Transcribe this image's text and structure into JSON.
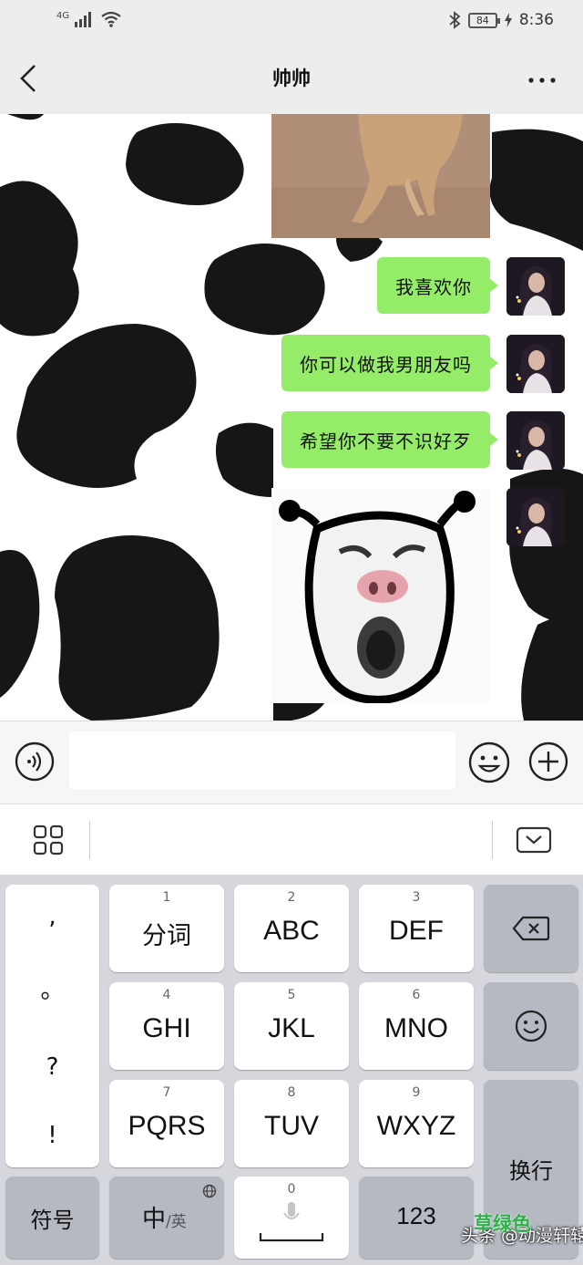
{
  "status_bar": {
    "network": "4G",
    "battery": "84",
    "time": "8:36"
  },
  "header": {
    "title": "帅帅"
  },
  "messages": [
    {
      "text": "我喜欢你"
    },
    {
      "text": "你可以做我男朋友吗"
    },
    {
      "text": "希望你不要不识好歹"
    }
  ],
  "input": {
    "value": ""
  },
  "keyboard": {
    "punctuation": [
      ",",
      "。",
      "?",
      "!"
    ],
    "keys": [
      {
        "num": "1",
        "label": "分词"
      },
      {
        "num": "2",
        "label": "ABC"
      },
      {
        "num": "3",
        "label": "DEF"
      },
      {
        "num": "4",
        "label": "GHI"
      },
      {
        "num": "5",
        "label": "JKL"
      },
      {
        "num": "6",
        "label": "MNO"
      },
      {
        "num": "7",
        "label": "PQRS"
      },
      {
        "num": "8",
        "label": "TUV"
      },
      {
        "num": "9",
        "label": "WXYZ"
      }
    ],
    "symbols_label": "符号",
    "lang_label_main": "中",
    "lang_label_sub": "/英",
    "space_num": "0",
    "num_label": "123",
    "enter_label": "换行"
  },
  "watermark": {
    "top": "草绿色",
    "bottom": "头条 @动漫轩辕"
  }
}
